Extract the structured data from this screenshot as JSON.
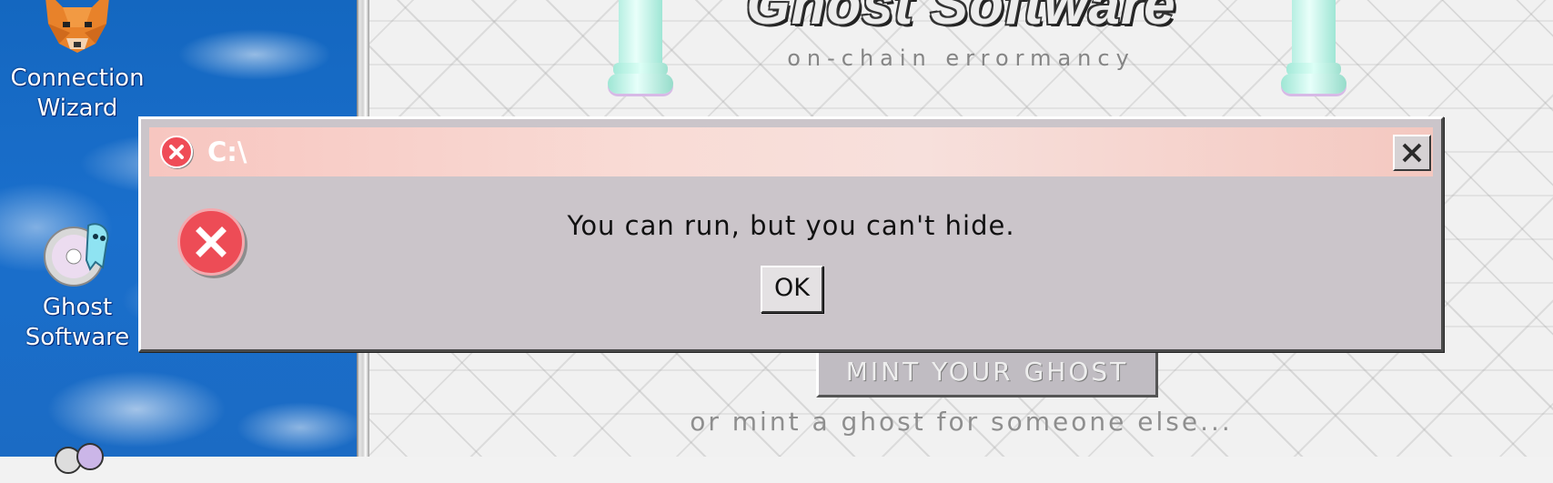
{
  "desktop": {
    "icons": [
      {
        "label_line1": "Connection",
        "label_line2": "Wizard",
        "icon": "fox-icon"
      },
      {
        "label_line1": "Ghost",
        "label_line2": "Software",
        "icon": "ghost-cd-icon"
      }
    ]
  },
  "page": {
    "title": "Ghost Software",
    "subtitle": "on-chain errormancy",
    "mint_button_label": "MINT YOUR GHOST",
    "mint_other_text": "or mint a ghost for someone else..."
  },
  "dialog": {
    "title": "C:\\",
    "message": "You can run, but you can't hide.",
    "ok_label": "OK",
    "close_icon": "close-icon",
    "error_icon": "error-icon",
    "accent": "#ed4c56"
  }
}
